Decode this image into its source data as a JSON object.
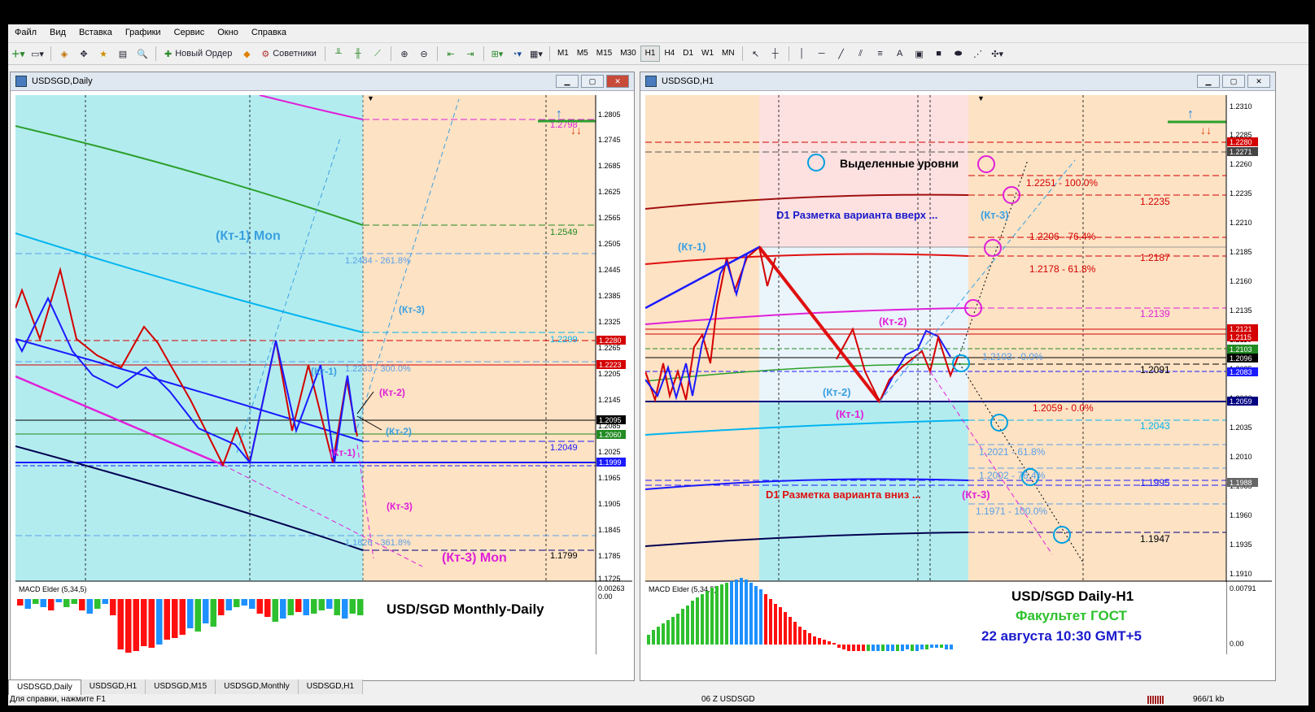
{
  "menu": [
    "Файл",
    "Вид",
    "Вставка",
    "Графики",
    "Сервис",
    "Окно",
    "Справка"
  ],
  "toolbar": {
    "new_order": "Новый Ордер",
    "experts": "Советники",
    "timeframes": [
      "M1",
      "M5",
      "M15",
      "M30",
      "H1",
      "H4",
      "D1",
      "W1",
      "MN"
    ],
    "active_timeframe": "H1"
  },
  "left": {
    "title": "USDSGD,Daily",
    "price_scale": [
      "1.2805",
      "1.2745",
      "1.2685",
      "1.2625",
      "1.2565",
      "1.2505",
      "1.2445",
      "1.2385",
      "1.2325",
      "1.2265",
      "1.2205",
      "1.2145",
      "1.2085",
      "1.2025",
      "1.1965",
      "1.1905",
      "1.1845",
      "1.1785",
      "1.1725"
    ],
    "tags": [
      {
        "text": "1.2280",
        "color": "#d40000"
      },
      {
        "text": "1.2223",
        "color": "#d40000"
      },
      {
        "text": "1.2095",
        "color": "#000000"
      },
      {
        "text": "1.2060",
        "color": "#228b22"
      },
      {
        "text": "1.1999",
        "color": "#1a1aff"
      }
    ],
    "labels": {
      "kt1_mon": "(Кт-1) Mon",
      "kt3_mon": "(Кт-3) Mon",
      "kt3_blue": "(Кт-3)",
      "kt1_blue": "(Кт-1)",
      "kt2_magenta": "(Кт-2)",
      "kt2_blue": "(Кт-2)",
      "kt1_magenta": "(Кт-1)",
      "kt3_magenta": "(Кт-3)",
      "lvl_2798": "1.2798",
      "lvl_2549": "1.2549",
      "lvl_2484": "1.2484 - 261.8%",
      "lvl_2299": "1.2299",
      "lvl_2233": "1.2233 - 300.0%",
      "lvl_2049": "1.2049",
      "lvl_1826": "1.1826 - 361.8%",
      "lvl_1799": "1.1799"
    },
    "macd": {
      "label": "MACD Elder (5,34,5)",
      "top": "0.00263",
      "zero": "0.00"
    },
    "caption": "USD/SGD Monthly-Daily"
  },
  "right": {
    "title": "USDSGD,H1",
    "price_scale": [
      "1.2310",
      "1.2285",
      "1.2260",
      "1.2235",
      "1.2210",
      "1.2185",
      "1.2160",
      "1.2135",
      "1.2110",
      "1.2085",
      "1.2060",
      "1.2035",
      "1.2010",
      "1.1985",
      "1.1960",
      "1.1935",
      "1.1910"
    ],
    "tags": [
      {
        "text": "1.2280",
        "color": "#d40000"
      },
      {
        "text": "1.2271",
        "color": "#444444"
      },
      {
        "text": "1.2121",
        "color": "#d40000"
      },
      {
        "text": "1.2115",
        "color": "#d40000"
      },
      {
        "text": "1.2103",
        "color": "#228b22"
      },
      {
        "text": "1.2096",
        "color": "#000000"
      },
      {
        "text": "1.2083",
        "color": "#1a1aff"
      },
      {
        "text": "1.2059",
        "color": "#000080"
      },
      {
        "text": "1.1988",
        "color": "#666666"
      }
    ],
    "labels": {
      "highlighted": "Выделенные уровни",
      "d1_up": "D1 Разметка варианта вверх ...",
      "d1_down": "D1 Разметка варианта вниз ...",
      "kt3_up": "(Кт-3)",
      "kt3_down": "(Кт-3)",
      "kt1_blue": "(Кт-1)",
      "kt2_magenta": "(Кт-2)",
      "kt2_blue": "(Кт-2)",
      "kt1_magenta": "(Кт-1)",
      "lvl_2251": "1.2251 - 100.0%",
      "lvl_2235": "1.2235",
      "lvl_2206": "1.2206 - 76.4%",
      "lvl_2187": "1.2187",
      "lvl_2178": "1.2178 - 61.8%",
      "lvl_2139": "1.2139",
      "lvl_2103": "1.2103 - 0.0%",
      "lvl_2091": "1.2091",
      "lvl_2059": "1.2059 - 0.0%",
      "lvl_2043": "1.2043",
      "lvl_2021": "1.2021 - 61.8%",
      "lvl_2002": "1.2002 - 76.4%",
      "lvl_1995": "1.1995",
      "lvl_1971": "1.1971 - 100.0%",
      "lvl_1947": "1.1947"
    },
    "macd": {
      "label": "MACD Elder (5,34,5)",
      "top": "0.00791",
      "zero": "0.00"
    },
    "caption1": "USD/SGD Daily-H1",
    "caption2": "Факультет ГОСТ",
    "caption3": "22 августа 10:30   GMT+5"
  },
  "tabs": [
    "USDSGD,Daily",
    "USDSGD,H1",
    "USDSGD,M15",
    "USDSGD,Monthly",
    "USDSGD,H1"
  ],
  "status": {
    "help": "Для справки, нажмите F1",
    "profile": "06 Z USDSGD",
    "traffic": "966/1 kb"
  }
}
